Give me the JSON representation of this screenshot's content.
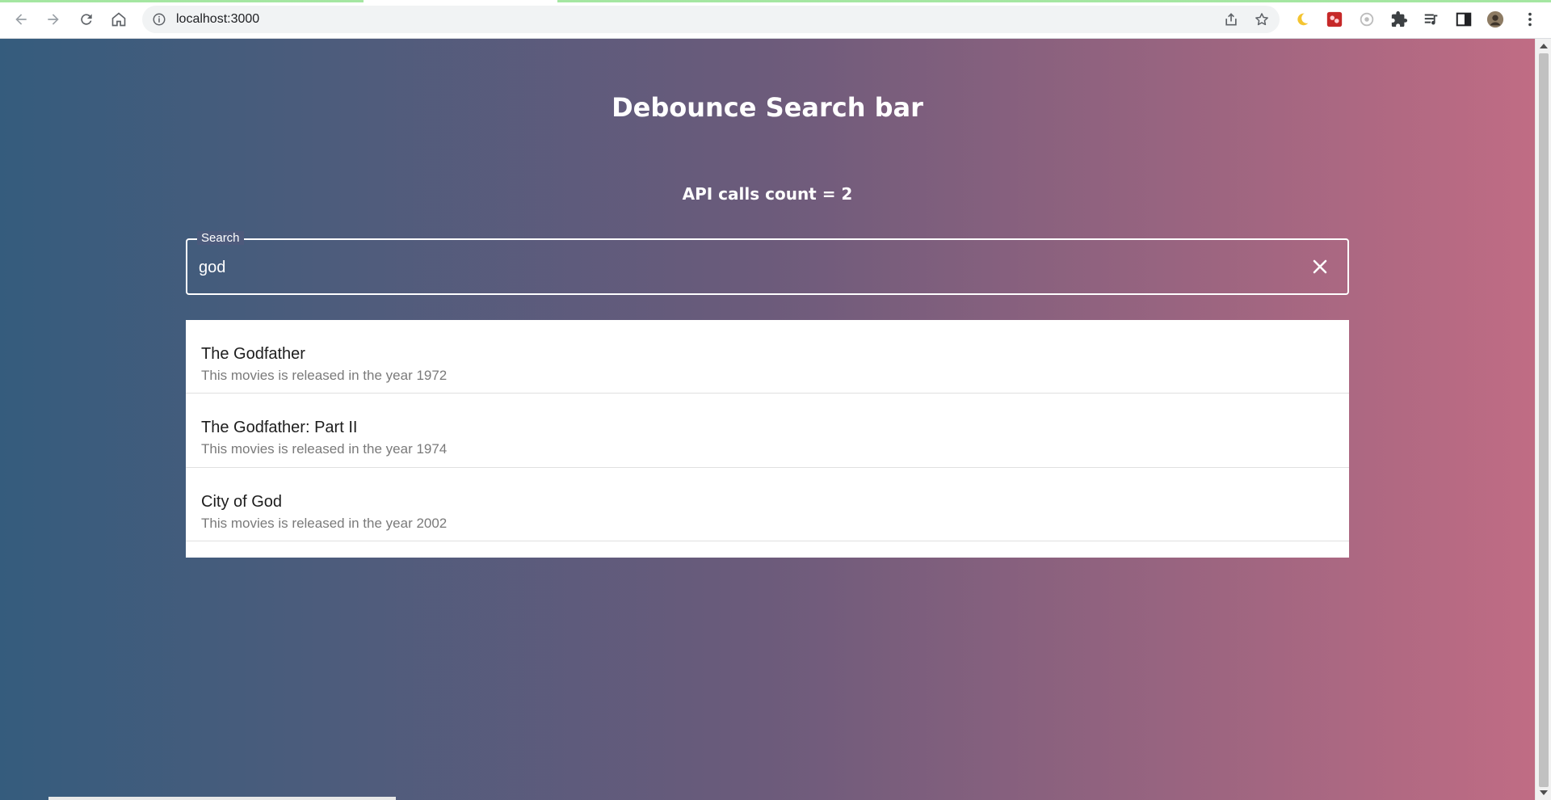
{
  "browser": {
    "url": "localhost:3000",
    "nav_icons": [
      "back-arrow-icon",
      "forward-arrow-icon",
      "reload-icon",
      "home-icon"
    ],
    "omnibox_icons": [
      "info-icon",
      "share-icon",
      "star-icon"
    ],
    "extension_icons": [
      "moon-icon",
      "game-extension-icon",
      "circle-extension-icon",
      "puzzle-icon",
      "media-queue-icon",
      "side-panel-icon",
      "profile-avatar",
      "kebab-menu-icon"
    ]
  },
  "app": {
    "title": "Debounce Search bar",
    "api_count_label": "API calls count = 2",
    "search": {
      "label": "Search",
      "value": "god",
      "clear_icon": "close-icon"
    },
    "results": [
      {
        "title": "The Godfather",
        "subtitle": "This movies is released in the year 1972"
      },
      {
        "title": "The Godfather: Part II",
        "subtitle": "This movies is released in the year 1974"
      },
      {
        "title": "City of God",
        "subtitle": "This movies is released in the year 2002"
      }
    ]
  },
  "colors": {
    "gradient_start": "#355c7d",
    "gradient_mid": "#6c5b7b",
    "gradient_end": "#c06c84",
    "text_light": "#ffffff"
  }
}
